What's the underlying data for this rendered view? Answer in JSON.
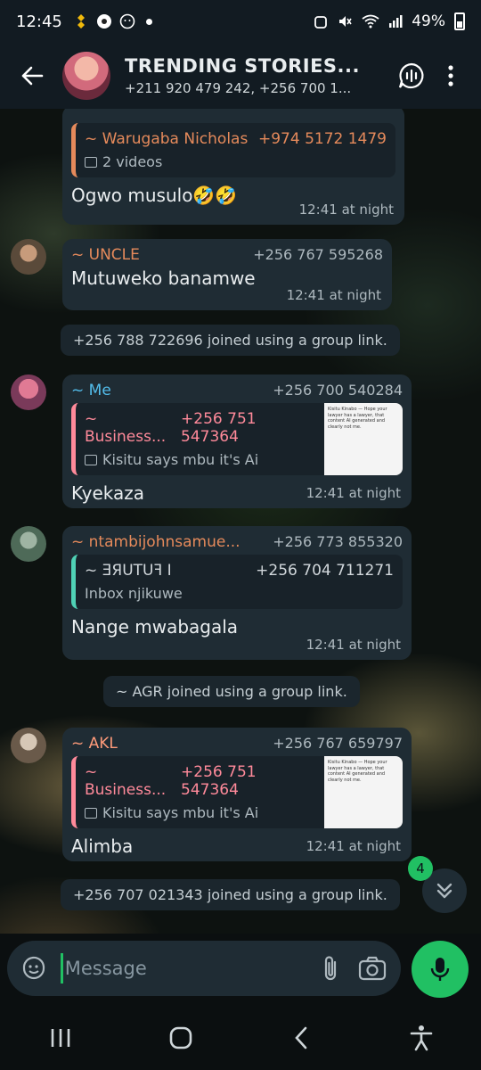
{
  "status_bar": {
    "time": "12:45",
    "battery": "49%"
  },
  "header": {
    "title": "TRENDING STORIES...",
    "subtitle": "+211 920 479 242, +256 700 1..."
  },
  "messages": [
    {
      "quote_sender": "~ Warugaba Nicholas",
      "quote_phone": "+974 5172 1479",
      "quote_text": "2 videos",
      "text": "Ogwo musulo🤣🤣",
      "time": "12:41 at night"
    },
    {
      "sender": "~ UNCLE",
      "phone": "+256 767 595268",
      "text": "Mutuweko banamwe",
      "time": "12:41 at night"
    },
    {
      "system": "+256 788 722696 joined using a group link."
    },
    {
      "sender": "~ Me",
      "phone": "+256 700 540284",
      "quote_sender": "~ Business...",
      "quote_phone": "+256 751 547364",
      "quote_text": "Kisitu says mbu it's Ai",
      "text": "Kyekaza",
      "time": "12:41 at night"
    },
    {
      "sender": "~ ntambijohnsamue...",
      "phone": "+256 773 855320",
      "quote_sender": "~ ƎЯUTUꟻ I",
      "quote_phone": "+256 704 711271",
      "quote_text": "Inbox njikuwe",
      "text": "Nange mwabagala",
      "time": "12:41 at night"
    },
    {
      "system": "~ AGR joined using a group link."
    },
    {
      "sender": "~ AKL",
      "phone": "+256 767 659797",
      "quote_sender": "~ Business...",
      "quote_phone": "+256 751 547364",
      "quote_text": "Kisitu says mbu it's Ai",
      "text": "Alimba",
      "time": "12:41 at night"
    },
    {
      "system": "+256 707 021343 joined using a group link."
    }
  ],
  "thumbnail_text": "Kisitu Kinabo — Hope your lawyer has a lawyer, that content AI generated and clearly not me.",
  "unread_count": "4",
  "composer": {
    "placeholder": "Message"
  },
  "colors": {
    "accent": "#21c063",
    "warugaba_name": "#e58a5b",
    "uncle_name": "#e58a5b",
    "me_name": "#53bdeb",
    "business_name": "#ff8a9a",
    "ntambi_name": "#e58a5b",
    "future_name": "#d1d7db",
    "akl_name": "#ff9b7a"
  }
}
